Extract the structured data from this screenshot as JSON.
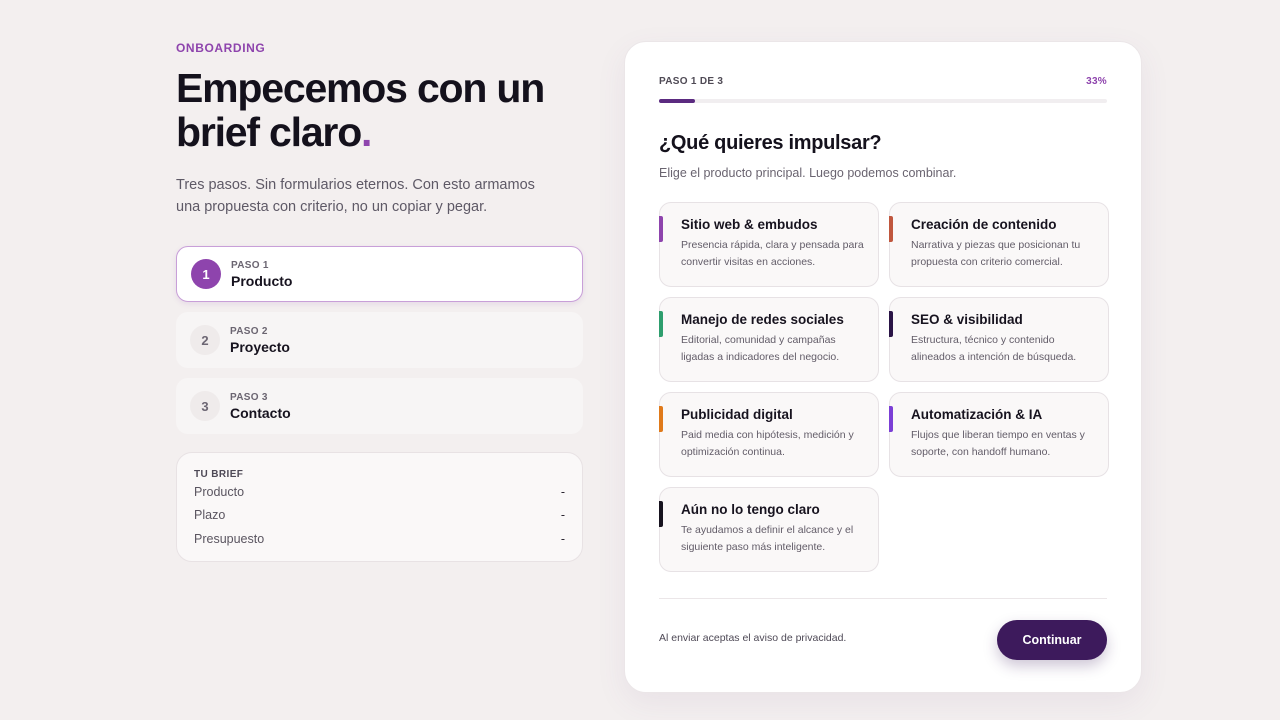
{
  "left": {
    "eyebrow": "ONBOARDING",
    "headline_line1": "Empecemos con un",
    "headline_line2": "brief claro",
    "headline_dot": ".",
    "lead": "Tres pasos. Sin formularios eternos. Con esto armamos una propuesta con criterio, no un copiar y pegar."
  },
  "steps": [
    {
      "num": "1",
      "label": "PASO 1",
      "title": "Producto",
      "active": true
    },
    {
      "num": "2",
      "label": "PASO 2",
      "title": "Proyecto",
      "active": false
    },
    {
      "num": "3",
      "label": "PASO 3",
      "title": "Contacto",
      "active": false
    }
  ],
  "brief": {
    "title": "TU BRIEF",
    "rows": [
      {
        "label": "Producto",
        "value": "-"
      },
      {
        "label": "Plazo",
        "value": "-"
      },
      {
        "label": "Presupuesto",
        "value": "-"
      }
    ]
  },
  "card": {
    "step_label": "PASO 1 DE 3",
    "progress_text": "33%",
    "progress_fraction": 0.08,
    "question": "¿Qué quieres impulsar?",
    "subtitle": "Elige el producto principal. Luego podemos combinar.",
    "options": [
      {
        "title": "Sitio web & embudos",
        "desc": "Presencia rápida, clara y pensada para convertir visitas en acciones.",
        "color": "#8e44ad"
      },
      {
        "title": "Creación de contenido",
        "desc": "Narrativa y piezas que posicionan tu propuesta con criterio comercial.",
        "color": "#c0573e"
      },
      {
        "title": "Manejo de redes sociales",
        "desc": "Editorial, comunidad y campañas ligadas a indicadores del negocio.",
        "color": "#2e9e6e"
      },
      {
        "title": "SEO & visibilidad",
        "desc": "Estructura, técnico y contenido alineados a intención de búsqueda.",
        "color": "#2a1446"
      },
      {
        "title": "Publicidad digital",
        "desc": "Paid media con hipótesis, medición y optimización continua.",
        "color": "#e07a1a"
      },
      {
        "title": "Automatización & IA",
        "desc": "Flujos que liberan tiempo en ventas y soporte, con handoff humano.",
        "color": "#7b3fd6"
      },
      {
        "title": "Aún no lo tengo claro",
        "desc": "Te ayudamos a definir el alcance y el siguiente paso más inteligente.",
        "color": "#17131f"
      }
    ],
    "footer_note": "Al enviar aceptas el aviso de privacidad.",
    "continue_label": "Continuar"
  }
}
